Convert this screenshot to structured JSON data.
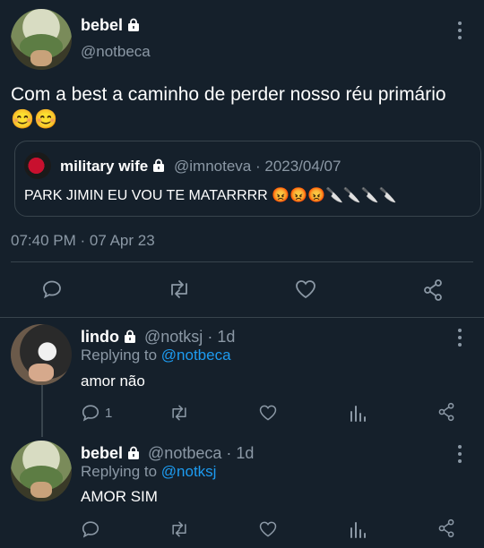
{
  "main_tweet": {
    "display_name": "bebel",
    "handle": "@notbeca",
    "text": "Com a best a caminho de perder nosso réu primário 😊😊",
    "timestamp": "07:40 PM · 07 Apr 23",
    "quoted": {
      "display_name": "military wife",
      "handle": "@imnoteva",
      "date": "· 2023/04/07",
      "text": "PARK JIMIN EU VOU TE MATARRRR 😡😡😡🔪🔪🔪🔪"
    }
  },
  "replies": [
    {
      "display_name": "lindo",
      "handle": "@notksj",
      "time": "· 1d",
      "replying_prefix": "Replying to",
      "replying_to": "@notbeca",
      "text": "amor não",
      "reply_count": "1"
    },
    {
      "display_name": "bebel",
      "handle": "@notbeca",
      "time": "· 1d",
      "replying_prefix": "Replying to",
      "replying_to": "@notksj",
      "text": "AMOR SIM",
      "reply_count": ""
    }
  ],
  "icons": [
    "lock-icon",
    "more-icon",
    "reply-icon",
    "retweet-icon",
    "like-icon",
    "share-icon",
    "analytics-icon"
  ],
  "colors": {
    "background": "#15202b",
    "muted": "#8b98a5",
    "link": "#1d9bf0",
    "divider": "#38444d"
  }
}
